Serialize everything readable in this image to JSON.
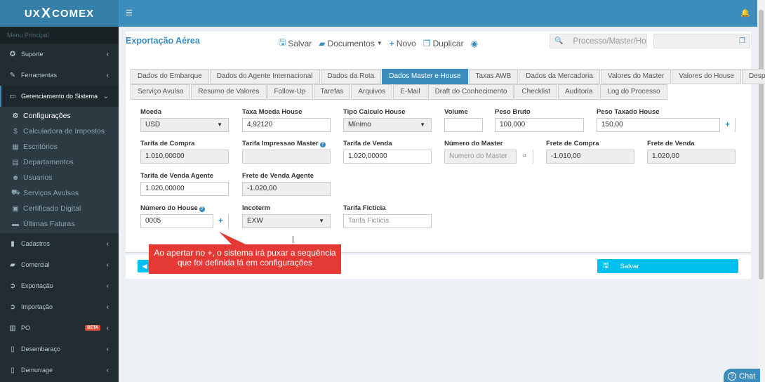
{
  "brand": {
    "left": "UX",
    "mid": "X",
    "right": "COMEX"
  },
  "sidebar": {
    "header": "Menu Principal",
    "items_top": [
      {
        "icon": "support-icon",
        "glyph": "✪",
        "label": "Suporte"
      },
      {
        "icon": "wrench-icon",
        "glyph": "✎",
        "label": "Ferramentas"
      },
      {
        "icon": "laptop-icon",
        "glyph": "▭",
        "label": "Gerenciamento do Sistema"
      }
    ],
    "submenu": [
      {
        "icon": "gears-icon",
        "glyph": "⚙",
        "label": "Configurações"
      },
      {
        "icon": "dollar-icon",
        "glyph": "$",
        "label": "Calculadora de Impostos"
      },
      {
        "icon": "building-icon",
        "glyph": "▦",
        "label": "Escritórios"
      },
      {
        "icon": "sitemap-icon",
        "glyph": "▤",
        "label": "Departamentos"
      },
      {
        "icon": "users-icon",
        "glyph": "☻",
        "label": "Usuarios"
      },
      {
        "icon": "truck-icon",
        "glyph": "⛟",
        "label": "Serviços Avulsos"
      },
      {
        "icon": "certificate-icon",
        "glyph": "▣",
        "label": "Certificado Digital"
      },
      {
        "icon": "credit-card-icon",
        "glyph": "▬",
        "label": "Últimas Faturas"
      }
    ],
    "items_bottom": [
      {
        "icon": "book-icon",
        "glyph": "▮",
        "label": "Cadastros"
      },
      {
        "icon": "briefcase-icon",
        "glyph": "▰",
        "label": "Comercial"
      },
      {
        "icon": "export-icon",
        "glyph": "➲",
        "label": "Exportação"
      },
      {
        "icon": "import-icon",
        "glyph": "➲",
        "label": "Importação"
      },
      {
        "icon": "chart-icon",
        "glyph": "▥",
        "label": "PO",
        "badge": "BETA"
      },
      {
        "icon": "file-icon",
        "glyph": "▯",
        "label": "Desembaraço"
      },
      {
        "icon": "file-icon",
        "glyph": "▯",
        "label": "Demurrage"
      }
    ]
  },
  "page": {
    "title": "Exportação Aérea",
    "toolbar": {
      "save": "Salvar",
      "documents": "Documentos",
      "new": "Novo",
      "duplicate": "Duplicar"
    },
    "search_placeholder": "Processo/Master/Ho"
  },
  "tabs_row1": [
    "Dados do Embarque",
    "Dados do Agente Internacional",
    "Dados da Rota",
    "Dados Master e House",
    "Taxas AWB",
    "Dados da Mercadoria",
    "Valores do Master",
    "Valores do House",
    "Despesas"
  ],
  "tabs_row2": [
    "Serviço Avulso",
    "Resumo de Valores",
    "Follow-Up",
    "Tarefas",
    "Arquivos",
    "E-Mail",
    "Draft do Conhecimento",
    "Checklist",
    "Auditoria",
    "Log do Processo"
  ],
  "active_tab": "Dados Master e House",
  "form": {
    "moeda": {
      "label": "Moeda",
      "value": "USD"
    },
    "taxa_moeda_house": {
      "label": "Taxa Moeda House",
      "value": "4,92120"
    },
    "tipo_calculo_house": {
      "label": "Tipo Calculo House",
      "value": "Mínimo"
    },
    "volume": {
      "label": "Volume",
      "value": ""
    },
    "peso_bruto": {
      "label": "Peso Bruto",
      "value": "100,000"
    },
    "peso_taxado_house": {
      "label": "Peso Taxado House",
      "value": "150,00"
    },
    "tarifa_compra": {
      "label": "Tarifa de Compra",
      "value": "1.010,00000"
    },
    "tarifa_impressao_master": {
      "label": "Tarifa Impressao Master",
      "value": ""
    },
    "tarifa_venda": {
      "label": "Tarifa de Venda",
      "value": "1.020,00000"
    },
    "numero_master": {
      "label": "Número do Master",
      "placeholder": "Numero do Master"
    },
    "frete_compra": {
      "label": "Frete de Compra",
      "value": "-1.010,00"
    },
    "frete_venda": {
      "label": "Frete de Venda",
      "value": "1.020,00"
    },
    "tarifa_venda_agente": {
      "label": "Tarifa de Venda Agente",
      "value": "1.020,00000"
    },
    "frete_venda_agente": {
      "label": "Frete de Venda Agente",
      "value": "-1.020,00"
    },
    "numero_house": {
      "label": "Número do House",
      "value": "0005"
    },
    "incoterm": {
      "label": "Incoterm",
      "value": "EXW"
    },
    "tarifa_ficticia": {
      "label": "Tarifa Ficticia",
      "placeholder": "Tarifa Ficticia"
    }
  },
  "save_button": "Salvar",
  "tooltip": "Ao apertar no +, o sistema irá puxar a sequência que foi definida lá em configurações",
  "chat": "Chat",
  "colors": {
    "primary": "#3c8dbc",
    "sidebar": "#222d32",
    "info": "#00c0ef",
    "tooltip": "#e53935"
  }
}
